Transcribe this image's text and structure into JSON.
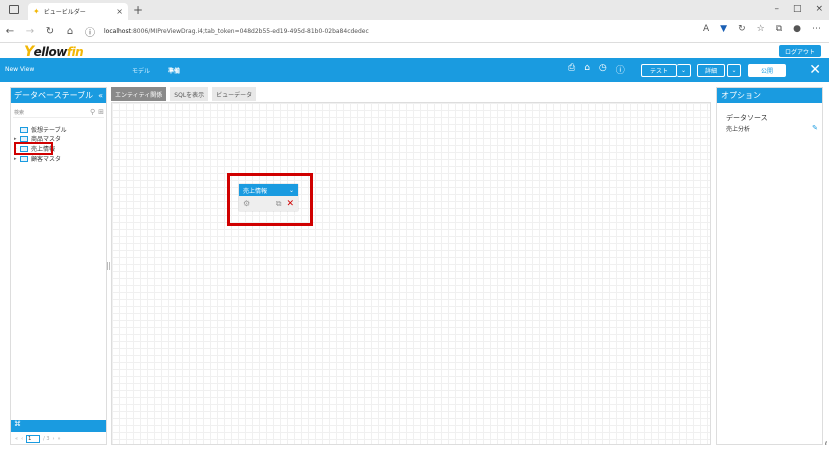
{
  "browser": {
    "tab_title": "ビュービルダー",
    "new_tab": "+",
    "tab_close": "×",
    "address_host": "localhost",
    "address_rest": ":8006/MIPreViewDrag.i4;tab_token=048d2b55-ed19-495d-81b0-02ba84cdedec",
    "window_controls": [
      "–",
      "□",
      "×"
    ],
    "nav_icons": [
      "back-icon",
      "forward-icon",
      "refresh-icon",
      "home-icon",
      "info-icon"
    ]
  },
  "header": {
    "logo_y": "Y",
    "logo_ellow": "ellow",
    "logo_fin": "fin",
    "logout_label": "ログアウト"
  },
  "toolbar": {
    "view_name": "New View",
    "tab_model": "モデル",
    "tab_prepare": "準備",
    "test_label": "テスト",
    "detail_label": "詳細",
    "publish_label": "公開",
    "close": "✕"
  },
  "left_panel": {
    "title": "データベーステーブル",
    "collapse": "«",
    "search_placeholder": "検索",
    "items": [
      {
        "label": "仮想テーブル",
        "expandable": false
      },
      {
        "label": "商品マスタ",
        "expandable": true
      },
      {
        "label": "売上情報",
        "expandable": true,
        "highlighted": true
      },
      {
        "label": "顧客マスタ",
        "expandable": true
      }
    ],
    "pager_current": "1",
    "pager_total": "/ 3"
  },
  "center": {
    "tabs": [
      {
        "label": "エンティティ関係",
        "active": true
      },
      {
        "label": "SQLを表示",
        "active": false
      },
      {
        "label": "ビューデータ",
        "active": false
      }
    ],
    "entity": {
      "title": "売上情報",
      "dropdown": "⌄"
    }
  },
  "right_panel": {
    "title": "オプション",
    "section_label": "データソース",
    "section_value": "売上分析"
  },
  "colors": {
    "accent": "#1a9be0",
    "highlight": "#d00000",
    "logo_yellow": "#f2b705"
  }
}
